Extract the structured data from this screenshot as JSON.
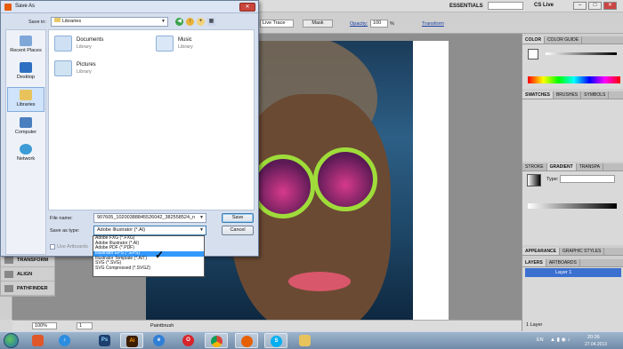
{
  "illustrator": {
    "workspace": "ESSENTIALS",
    "cs_live": "CS Live",
    "control": {
      "trace_preset": "Live Trace",
      "mask_btn": "Mask",
      "opacity_label": "Opacity:",
      "opacity_value": "100",
      "opacity_unit": "%",
      "transform_link": "Transform"
    },
    "panels": {
      "color_tabs": [
        "COLOR",
        "COLOR GUIDE"
      ],
      "swatch_tabs": [
        "SWATCHES",
        "BRUSHES",
        "SYMBOLS"
      ],
      "stroke_tabs": [
        "STROKE",
        "GRADIENT",
        "TRANSPA"
      ],
      "gradient_type_label": "Type:",
      "appearance_tabs": [
        "APPEARANCE",
        "GRAPHIC STYLES"
      ],
      "layers_tabs": [
        "LAYERS",
        "ARTBOARDS"
      ],
      "layer_name": "Layer 1",
      "layer_count": "1 Layer"
    },
    "left_panels": [
      "TRANSFORM",
      "ALIGN",
      "PATHFINDER"
    ],
    "status": {
      "zoom": "100%",
      "page": "1",
      "status_text": "Paintbrush"
    }
  },
  "dialog": {
    "title": "Save As",
    "save_in_label": "Save in:",
    "save_in_value": "Libraries",
    "places": [
      "Recent Places",
      "Desktop",
      "Libraries",
      "Computer",
      "Network"
    ],
    "libraries": [
      {
        "name": "Documents",
        "sub": "Library"
      },
      {
        "name": "Music",
        "sub": "Library"
      },
      {
        "name": "Pictures",
        "sub": "Library"
      }
    ],
    "filename_label": "File name:",
    "filename_value": "907605_10200388845526042_382558524_n",
    "savetype_label": "Save as type:",
    "savetype_value": "Adobe Illustrator (*.AI)",
    "save_btn": "Save",
    "cancel_btn": "Cancel",
    "artboards_label": "Use Artboards",
    "dropdown_options": [
      "Adobe FXG (*.FXG)",
      "Adobe Illustrator (*.AI)",
      "Adobe PDF (*.PDF)",
      "Illustrator EPS (*.EPS)",
      "Illustrator Template (*.AIT)",
      "SVG (*.SVG)",
      "SVG Compressed (*.SVGZ)"
    ],
    "selected_option_index": 3
  },
  "taskbar": {
    "apps": [
      "opera-like",
      "itunes",
      "photoshop",
      "illustrator",
      "ie",
      "opera",
      "chrome",
      "firefox",
      "skype",
      "explorer"
    ],
    "illustrator_label": "Ai",
    "photoshop_label": "Ps",
    "lang": "EN",
    "time": "20:36",
    "date": "27.04.2013"
  },
  "colors": {
    "selection_blue": "#3399ff",
    "layer_blue": "#3b6fd0",
    "lens_green": "#9fdc3a"
  }
}
